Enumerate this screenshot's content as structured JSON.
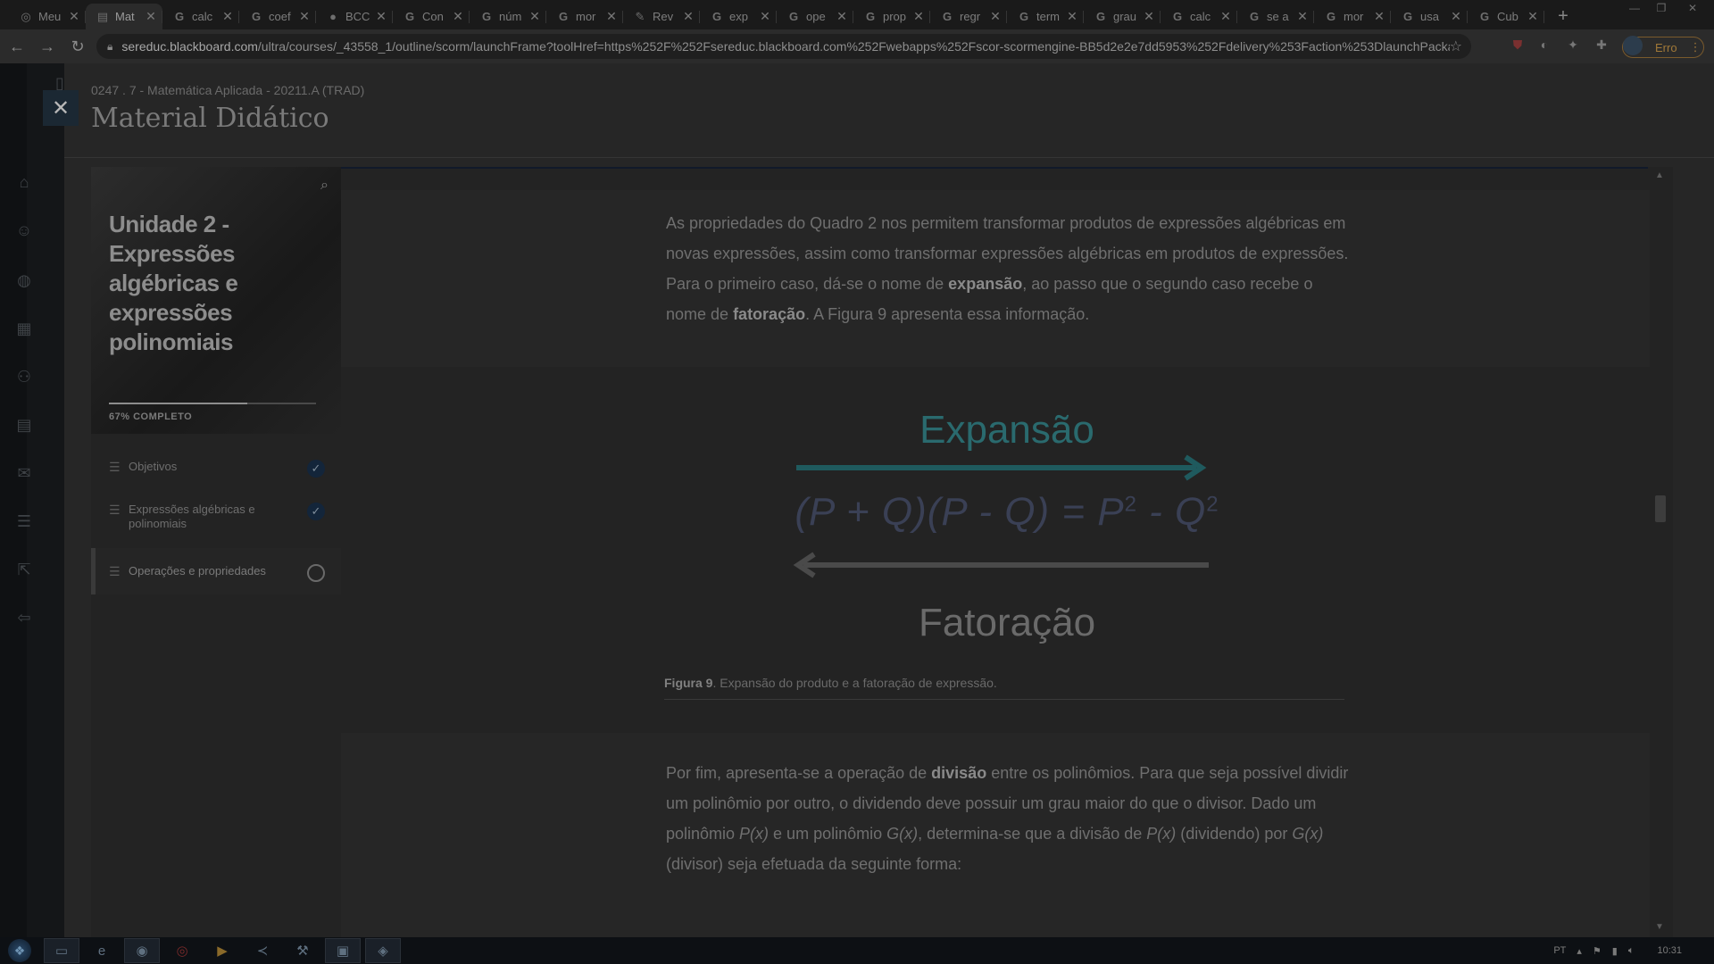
{
  "browser": {
    "tabs": [
      {
        "favicon": "maps-icon",
        "fav_char": "◎",
        "title": "Meu"
      },
      {
        "favicon": "book-icon",
        "fav_char": "▤",
        "title": "Mat",
        "active": true
      },
      {
        "favicon": "google-icon",
        "fav_char": "G",
        "title": "calc"
      },
      {
        "favicon": "google-icon",
        "fav_char": "G",
        "title": "coef"
      },
      {
        "favicon": "globe-icon",
        "fav_char": "●",
        "title": "BCC"
      },
      {
        "favicon": "google-icon",
        "fav_char": "G",
        "title": "Con"
      },
      {
        "favicon": "google-icon",
        "fav_char": "G",
        "title": "núm"
      },
      {
        "favicon": "google-icon",
        "fav_char": "G",
        "title": "mor"
      },
      {
        "favicon": "review-icon",
        "fav_char": "✎",
        "title": "Rev"
      },
      {
        "favicon": "google-icon",
        "fav_char": "G",
        "title": "exp"
      },
      {
        "favicon": "google-icon",
        "fav_char": "G",
        "title": "ope"
      },
      {
        "favicon": "google-icon",
        "fav_char": "G",
        "title": "prop"
      },
      {
        "favicon": "google-icon",
        "fav_char": "G",
        "title": "regr"
      },
      {
        "favicon": "google-icon",
        "fav_char": "G",
        "title": "term"
      },
      {
        "favicon": "google-icon",
        "fav_char": "G",
        "title": "grau"
      },
      {
        "favicon": "google-icon",
        "fav_char": "G",
        "title": "calc"
      },
      {
        "favicon": "google-icon",
        "fav_char": "G",
        "title": "se a"
      },
      {
        "favicon": "google-icon",
        "fav_char": "G",
        "title": "mor"
      },
      {
        "favicon": "google-icon",
        "fav_char": "G",
        "title": "usa"
      },
      {
        "favicon": "google-icon",
        "fav_char": "G",
        "title": "Cub"
      }
    ],
    "new_tab_label": "+",
    "url_domain": "sereduc.blackboard.com",
    "url_path": "/ultra/courses/_43558_1/outline/scorm/launchFrame?toolHref=https%252F%252Fsereduc.blackboard.com%252Fwebapps%252Fscor-scormengine-BB5d2e2e7dd5953%252Fdelivery%253Faction%253DlaunchPackage%26c...",
    "profile_button": "Erro"
  },
  "page": {
    "breadcrumb": "0247 . 7 - Matemática Aplicada - 20211.A (TRAD)",
    "title": "Material Didático"
  },
  "unit": {
    "title": "Unidade 2 - Expressões algébricas e expressões polinomiais",
    "progress_text": "67% COMPLETO",
    "progress_value": 0.67
  },
  "outline": [
    {
      "label": "Objetivos",
      "status": "done"
    },
    {
      "label": "Expressões algébricas e polinomiais",
      "status": "done"
    },
    {
      "label": "Operações e propriedades",
      "status": "todo"
    }
  ],
  "content": {
    "p1_a": "As propriedades do Quadro 2 nos permitem transformar produtos de expressões algébricas em novas expressões, assim como transformar expressões algébricas em produtos de expressões. Para o primeiro caso, dá-se o nome de ",
    "p1_b": "expansão",
    "p1_c": ", ao passo que o segundo caso recebe o nome de ",
    "p1_d": "fatoração",
    "p1_e": ". A Figura 9 apresenta essa informação.",
    "figure": {
      "top_label": "Expansão",
      "bottom_label": "Fatoração",
      "formula_left": "(P + Q)(P - Q) = P",
      "sup1": "2",
      "formula_mid": " - Q",
      "sup2": "2"
    },
    "caption_bold": "Figura 9",
    "caption_text": ". Expansão do produto e a fatoração de expressão.",
    "p2_a": "Por fim, apresenta-se a operação de ",
    "p2_b": "divisão",
    "p2_c": " entre os polinômios. Para que seja possível dividir um polinômio por outro, o dividendo deve possuir um grau maior do que o divisor. Dado um polinômio ",
    "p2_d": "P(x)",
    "p2_e": " e um polinômio ",
    "p2_f": "G(x)",
    "p2_g": ", determina-se que a divisão de ",
    "p2_h": "P(x)",
    "p2_i": " (dividendo) por ",
    "p2_j": "G(x)",
    "p2_k": " (divisor) seja efetuada da seguinte forma:"
  },
  "taskbar": {
    "lang": "PT",
    "time": "10:31",
    "apps": [
      "explorer-icon",
      "ie-icon",
      "chrome-icon",
      "record-icon",
      "media-icon",
      "vscode-icon",
      "tool-icon",
      "window-icon",
      "app-icon"
    ]
  },
  "colors": {
    "accent_teal": "#2a6a6e",
    "overlay_dark": "#232323"
  }
}
